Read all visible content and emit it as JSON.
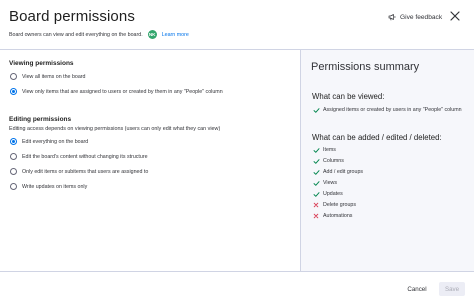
{
  "header": {
    "title": "Board permissions",
    "subtitle": "Board owners can view and edit everything on the board.",
    "avatar_initials": "NK",
    "learn_more": "Learn more",
    "feedback_label": "Give feedback",
    "feedback_icon": "megaphone-icon",
    "close_icon": "close-icon"
  },
  "viewing": {
    "title": "Viewing permissions",
    "options": [
      {
        "label": "View all items on the board",
        "checked": false
      },
      {
        "label": "View only items that are assigned to users or created by them in any \"People\" column",
        "checked": true
      }
    ]
  },
  "editing": {
    "title": "Editing permissions",
    "description": "Editing access depends on viewing permissions (users can only edit what they can view)",
    "options": [
      {
        "label": "Edit everything on the board",
        "checked": true
      },
      {
        "label": "Edit the board's content without changing its structure",
        "checked": false
      },
      {
        "label": "Only edit items or subitems that users are assigned to",
        "checked": false
      },
      {
        "label": "Write updates on items only",
        "checked": false
      }
    ]
  },
  "summary": {
    "title": "Permissions summary",
    "viewed_heading": "What can be viewed:",
    "viewed_items": [
      {
        "label": "Assigned items or created by users in any \"People\" column",
        "allowed": true
      }
    ],
    "edited_heading": "What can be added / edited / deleted:",
    "edited_items": [
      {
        "label": "Items",
        "allowed": true
      },
      {
        "label": "Columns",
        "allowed": true
      },
      {
        "label": "Add / edit groups",
        "allowed": true
      },
      {
        "label": "Views",
        "allowed": true
      },
      {
        "label": "Updates",
        "allowed": true
      },
      {
        "label": "Delete groups",
        "allowed": false
      },
      {
        "label": "Automations",
        "allowed": false
      }
    ]
  },
  "footer": {
    "cancel_label": "Cancel",
    "save_label": "Save"
  },
  "colors": {
    "accent": "#0073ea",
    "check": "#00854d",
    "cross": "#d83a52",
    "avatar": "#33a66d"
  }
}
